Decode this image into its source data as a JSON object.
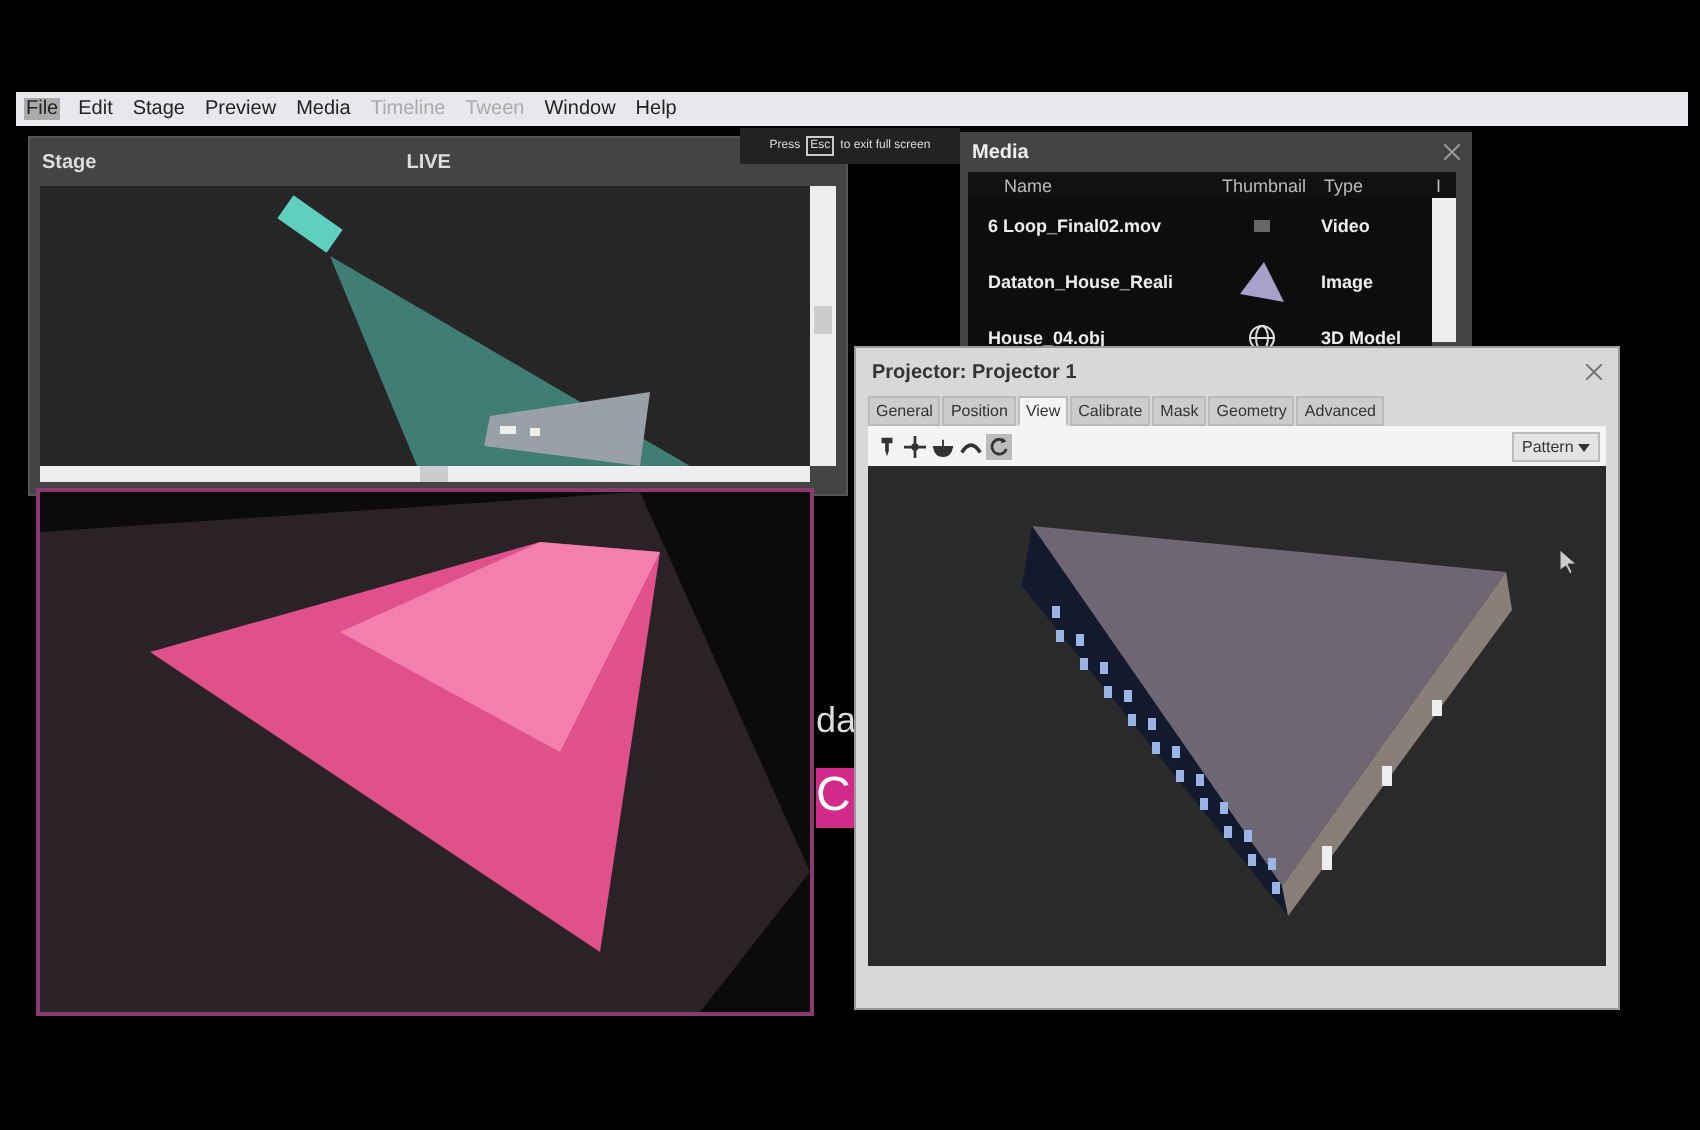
{
  "menu_bar": [
    {
      "label": "File",
      "selected": true,
      "disabled": false
    },
    {
      "label": "Edit",
      "selected": false,
      "disabled": false
    },
    {
      "label": "Stage",
      "selected": false,
      "disabled": false
    },
    {
      "label": "Preview",
      "selected": false,
      "disabled": false
    },
    {
      "label": "Media",
      "selected": false,
      "disabled": false
    },
    {
      "label": "Timeline",
      "selected": false,
      "disabled": true
    },
    {
      "label": "Tween",
      "selected": false,
      "disabled": true
    },
    {
      "label": "Window",
      "selected": false,
      "disabled": false
    },
    {
      "label": "Help",
      "selected": false,
      "disabled": false
    }
  ],
  "fullscreen_hint": {
    "before": "Press",
    "key": "Esc",
    "after": "to exit full screen"
  },
  "stage_window": {
    "title": "Stage",
    "status": "LIVE"
  },
  "background_text": [
    "da",
    "C"
  ],
  "media_window": {
    "title": "Media",
    "columns": [
      "Name",
      "Thumbnail",
      "Type",
      "I"
    ],
    "rows": [
      {
        "name": "6 Loop_Final02.mov",
        "kind": "video",
        "type": "Video"
      },
      {
        "name": "Dataton_House_Reali",
        "kind": "image",
        "type": "Image"
      },
      {
        "name": "House_04.obj",
        "kind": "model",
        "type": "3D Model"
      }
    ]
  },
  "projector_window": {
    "title": "Projector: Projector 1",
    "tabs": [
      {
        "label": "General",
        "selected": false
      },
      {
        "label": "Position",
        "selected": false
      },
      {
        "label": "View",
        "selected": true
      },
      {
        "label": "Calibrate",
        "selected": false
      },
      {
        "label": "Mask",
        "selected": false
      },
      {
        "label": "Geometry",
        "selected": false
      },
      {
        "label": "Advanced",
        "selected": false
      }
    ],
    "tools": [
      {
        "kind": "pin",
        "selected": false
      },
      {
        "kind": "move",
        "selected": false
      },
      {
        "kind": "bowl",
        "selected": false
      },
      {
        "kind": "arc",
        "selected": false
      },
      {
        "kind": "rotate",
        "selected": true
      }
    ],
    "dropdown": "Pattern"
  }
}
